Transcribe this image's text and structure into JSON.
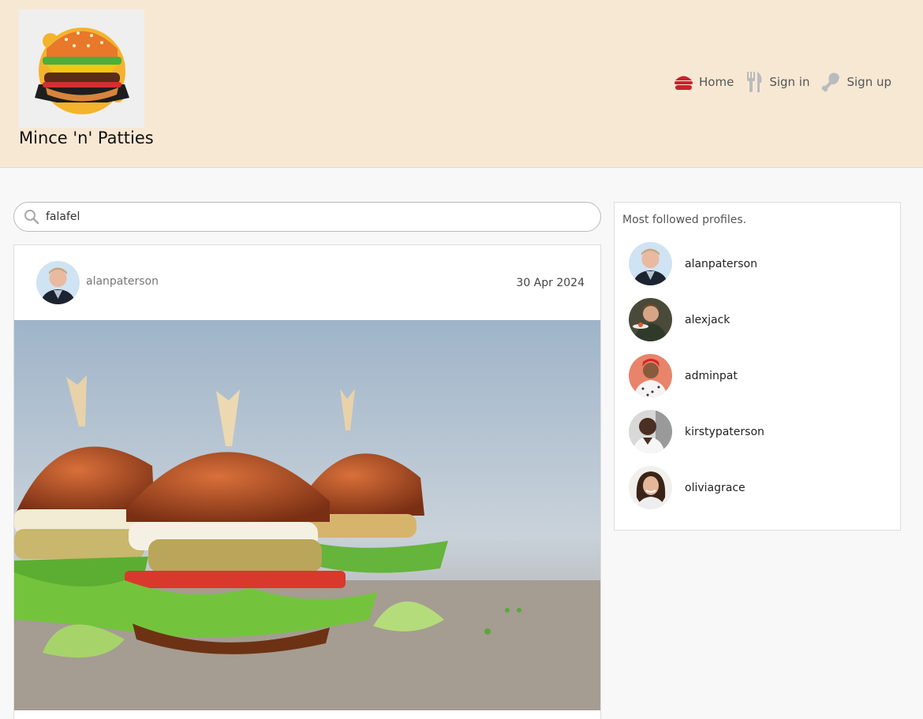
{
  "brand": {
    "name": "Mince 'n' Patties"
  },
  "nav": {
    "home": "Home",
    "signin": "Sign in",
    "signup": "Sign up"
  },
  "search": {
    "value": "falafel"
  },
  "post": {
    "author": "alanpaterson",
    "date": "30 Apr 2024"
  },
  "sidebar": {
    "title": "Most followed profiles.",
    "profiles": [
      {
        "name": "alanpaterson"
      },
      {
        "name": "alexjack"
      },
      {
        "name": "adminpat"
      },
      {
        "name": "kirstypaterson"
      },
      {
        "name": "oliviagrace"
      }
    ]
  },
  "colors": {
    "header_bg": "#f7e8d4",
    "accent_red": "#c8232c",
    "nav_icon_grey": "#b9bbbe"
  }
}
